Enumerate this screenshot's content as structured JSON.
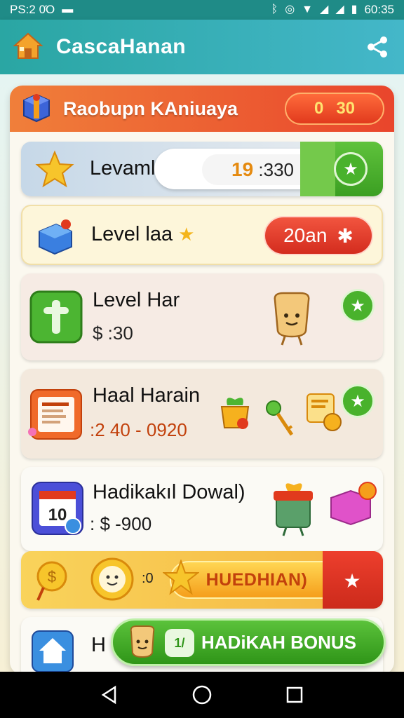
{
  "status_bar": {
    "left_text": "PS:2 0Ό",
    "time": "60:35",
    "icons": [
      "flag-icon",
      "bluetooth-icon",
      "alarm-icon",
      "wifi-icon",
      "signal-icon",
      "signal-icon",
      "battery-icon"
    ]
  },
  "app_bar": {
    "title": "CascaHanan",
    "icons": [
      "home-icon",
      "share-icon"
    ]
  },
  "card": {
    "header_title": "Raobupn KAniuaya",
    "coin_value": "30",
    "coin_symbol": "0"
  },
  "rows": [
    {
      "title": "Levamlan",
      "value_hl": "19",
      "value": ":330",
      "icon": "star-badge-icon",
      "accent": "#49b22c"
    },
    {
      "title": "Level laa",
      "pill_text": "20an",
      "icon": "gift-box-icon",
      "accent": "#e13a1d"
    },
    {
      "title": "Level Har",
      "value": "$ :30",
      "icon": "green-tile-icon",
      "accent": "#49b22c"
    },
    {
      "title": "Haal Harain",
      "value": ":2 40 - 0920",
      "icon": "document-icon",
      "accent": "#49b22c"
    },
    {
      "title": "Hadikakıl Dowal)",
      "value": ": $ -900",
      "icon": "calendar-icon",
      "calendar_number": "10"
    },
    {
      "title": "",
      "value": ":0",
      "bar_text": "HUEDHIAN)",
      "icon": "medal-icon"
    },
    {
      "title": "H"
    }
  ],
  "bonus_button": {
    "label": "HADiKAH BONUS",
    "badge": "1/"
  },
  "nav_bar": {
    "icons": [
      "back-icon",
      "home-circle-icon",
      "recents-icon"
    ]
  }
}
